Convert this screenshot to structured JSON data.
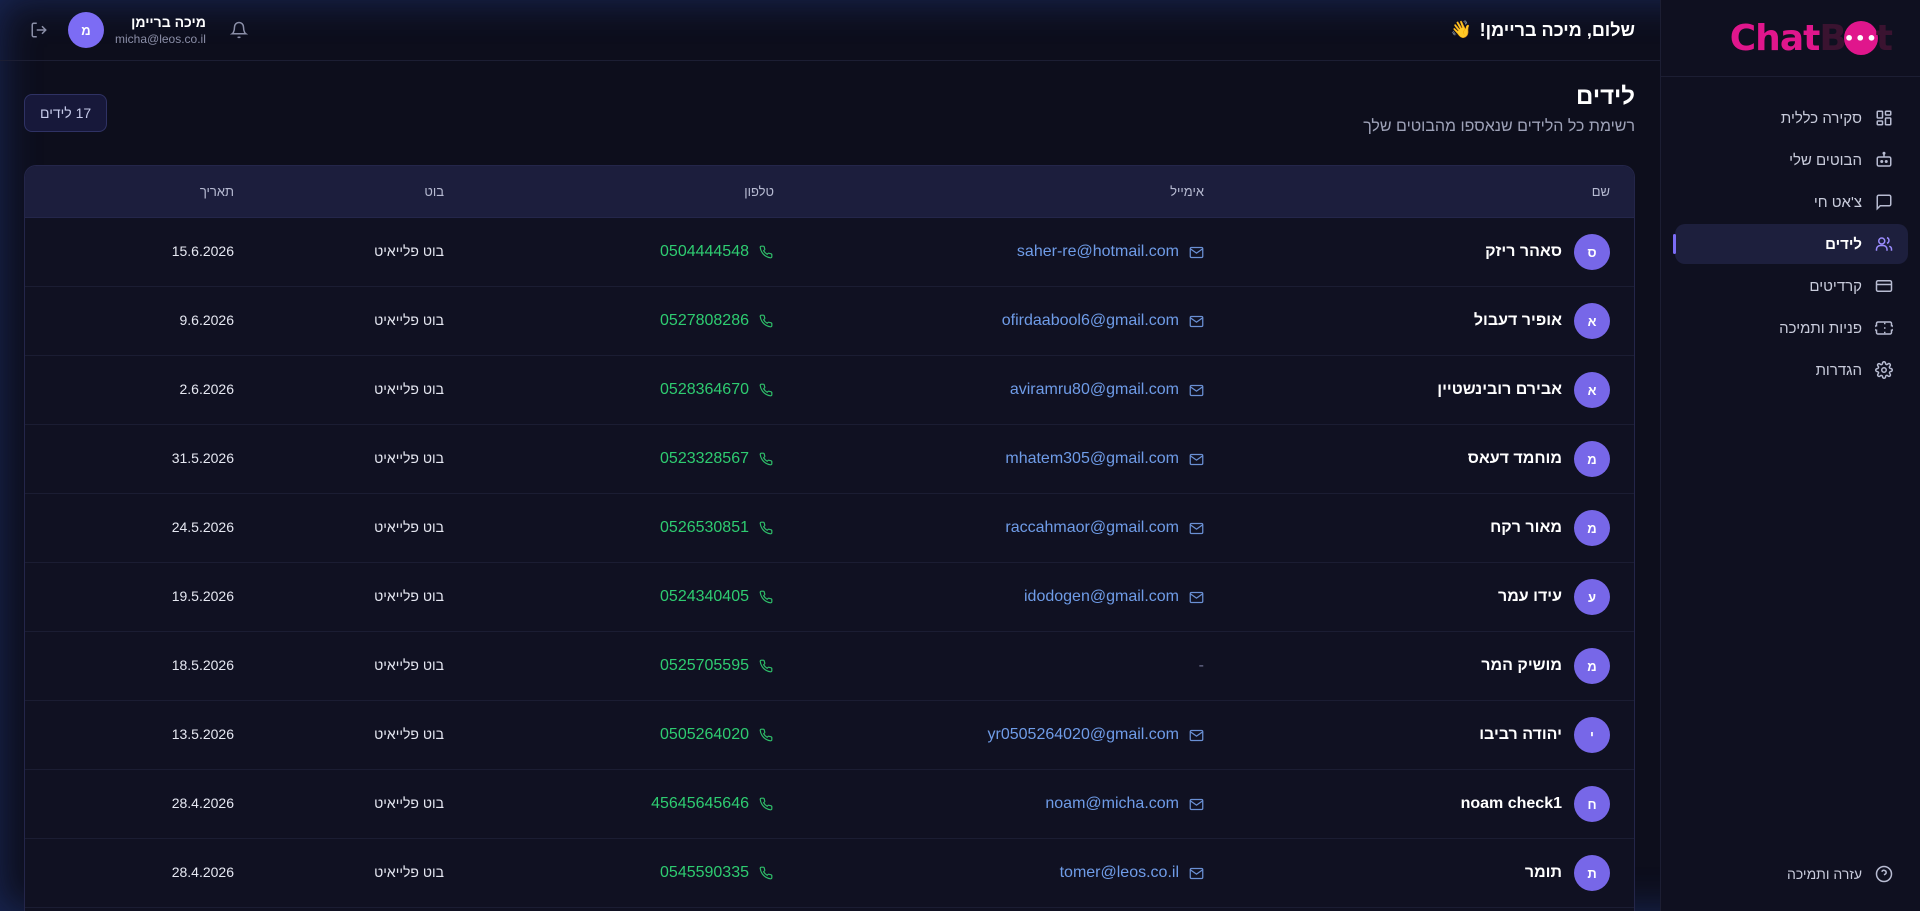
{
  "brand": {
    "logo_left": "Chat",
    "logo_right": "B",
    "logo_tail": "t",
    "accent": "#e0168c"
  },
  "sidebar": {
    "items": [
      {
        "label": "סקירה כללית",
        "icon": "dashboard-icon",
        "active": false
      },
      {
        "label": "הבוטים שלי",
        "icon": "bot-icon",
        "active": false
      },
      {
        "label": "צ'אט חי",
        "icon": "chat-icon",
        "active": false
      },
      {
        "label": "לידים",
        "icon": "users-icon",
        "active": true
      },
      {
        "label": "קרדיטים",
        "icon": "credit-card-icon",
        "active": false
      },
      {
        "label": "פניות ותמיכה",
        "icon": "ticket-icon",
        "active": false
      },
      {
        "label": "הגדרות",
        "icon": "gear-icon",
        "active": false
      }
    ],
    "help_label": "עזרה ותמיכה"
  },
  "header": {
    "greeting": "שלום, מיכה בריימן!",
    "wave": "👋",
    "user_name": "מיכה בריימן",
    "user_email": "micha@leos.co.il",
    "avatar_letter": "מ"
  },
  "page": {
    "title": "לידים",
    "subtitle": "רשימת כל הלידים שנאספו מהבוטים שלך",
    "count_badge": "17 לידים"
  },
  "table": {
    "columns": {
      "name": "שם",
      "email": "אימייל",
      "phone": "טלפון",
      "bot": "בוט",
      "date": "תאריך"
    },
    "rows": [
      {
        "initial": "ס",
        "name": "סאהר ריזק",
        "email": "saher-re@hotmail.com",
        "phone": "0504444548",
        "bot": "בוט פלייאיט",
        "date": "15.6.2026"
      },
      {
        "initial": "א",
        "name": "אופיר דעבול",
        "email": "ofirdaabool6@gmail.com",
        "phone": "0527808286",
        "bot": "בוט פלייאיט",
        "date": "9.6.2026"
      },
      {
        "initial": "א",
        "name": "אבירם רובינשטיין",
        "email": "aviramru80@gmail.com",
        "phone": "0528364670",
        "bot": "בוט פלייאיט",
        "date": "2.6.2026"
      },
      {
        "initial": "מ",
        "name": "מוחמד דעאס",
        "email": "mhatem305@gmail.com",
        "phone": "0523328567",
        "bot": "בוט פלייאיט",
        "date": "31.5.2026"
      },
      {
        "initial": "מ",
        "name": "מאור רקח",
        "email": "raccahmaor@gmail.com",
        "phone": "0526530851",
        "bot": "בוט פלייאיט",
        "date": "24.5.2026"
      },
      {
        "initial": "ע",
        "name": "עידו עמר",
        "email": "idodogen@gmail.com",
        "phone": "0524340405",
        "bot": "בוט פלייאיט",
        "date": "19.5.2026"
      },
      {
        "initial": "מ",
        "name": "מושיק המר",
        "email": "-",
        "phone": "0525705595",
        "bot": "בוט פלייאיט",
        "date": "18.5.2026"
      },
      {
        "initial": "י",
        "name": "יהודה רביבו",
        "email": "yr0505264020@gmail.com",
        "phone": "0505264020",
        "bot": "בוט פלייאיט",
        "date": "13.5.2026"
      },
      {
        "initial": "ח",
        "name": "noam check1",
        "email": "noam@micha.com",
        "phone": "45645645646",
        "bot": "בוט פלייאיט",
        "date": "28.4.2026"
      },
      {
        "initial": "ת",
        "name": "תומר",
        "email": "tomer@leos.co.il",
        "phone": "0545590335",
        "bot": "בוט פלייאיט",
        "date": "28.4.2026"
      }
    ]
  }
}
